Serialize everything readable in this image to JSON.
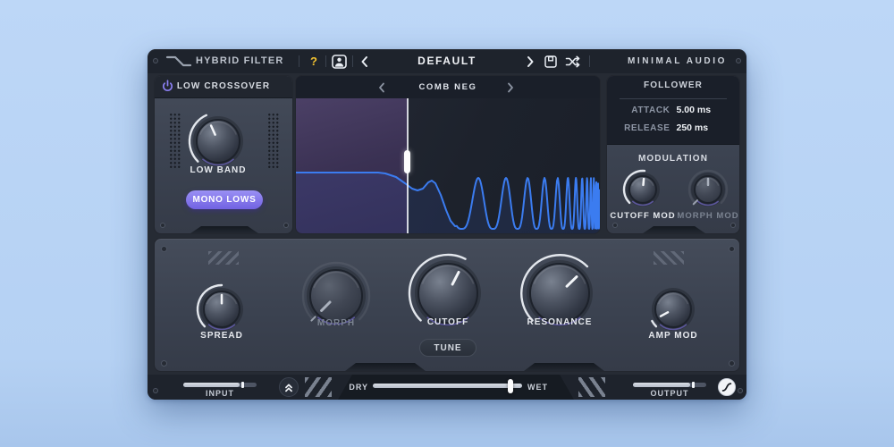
{
  "header": {
    "title": "HYBRID FILTER",
    "help": "?",
    "preset_name": "DEFAULT",
    "brand": "MINIMAL AUDIO"
  },
  "low_crossover": {
    "title": "LOW CROSSOVER",
    "knob_label": "LOW BAND",
    "mono_button_label": "MONO LOWS"
  },
  "display": {
    "title": "COMB NEG"
  },
  "follower": {
    "title": "FOLLOWER",
    "attack_label": "ATTACK",
    "attack_value": "5.00 ms",
    "release_label": "RELEASE",
    "release_value": "250 ms"
  },
  "modulation": {
    "title": "MODULATION",
    "cutoff_mod_label": "CUTOFF MOD",
    "morph_mod_label": "MORPH MOD"
  },
  "main": {
    "spread_label": "SPREAD",
    "morph_label": "MORPH",
    "cutoff_label": "CUTOFF",
    "tune_label": "TUNE",
    "resonance_label": "RESONANCE",
    "amp_mod_label": "AMP MOD"
  },
  "footer": {
    "input_label": "INPUT",
    "dry_label": "DRY",
    "wet_label": "WET",
    "output_label": "OUTPUT"
  },
  "state": {
    "knobs": {
      "low_band": 41,
      "spread": 50,
      "morph": 0,
      "cutoff": 60,
      "resonance": 67,
      "amp_mod": 6,
      "cutoff_mod": 52,
      "morph_mod": 50
    },
    "sliders": {
      "input_pct": 77,
      "dry_wet_pct": 92,
      "output_pct": 78
    }
  },
  "icons": {
    "logo": "filter-curve",
    "help": "question-mark",
    "user": "person",
    "prev": "chevron-left",
    "next": "chevron-right",
    "save": "floppy-disk",
    "randomize": "shuffle",
    "power": "power-symbol",
    "collapse": "double-chevron-up",
    "soft_clip": "s-curve"
  },
  "colors": {
    "accent_purple": "#8375ea",
    "accent_yellow": "#f2c230",
    "curve_blue": "#3b7cf0",
    "panel_bg": "#3a414e",
    "bar_bg": "#1e232c"
  }
}
